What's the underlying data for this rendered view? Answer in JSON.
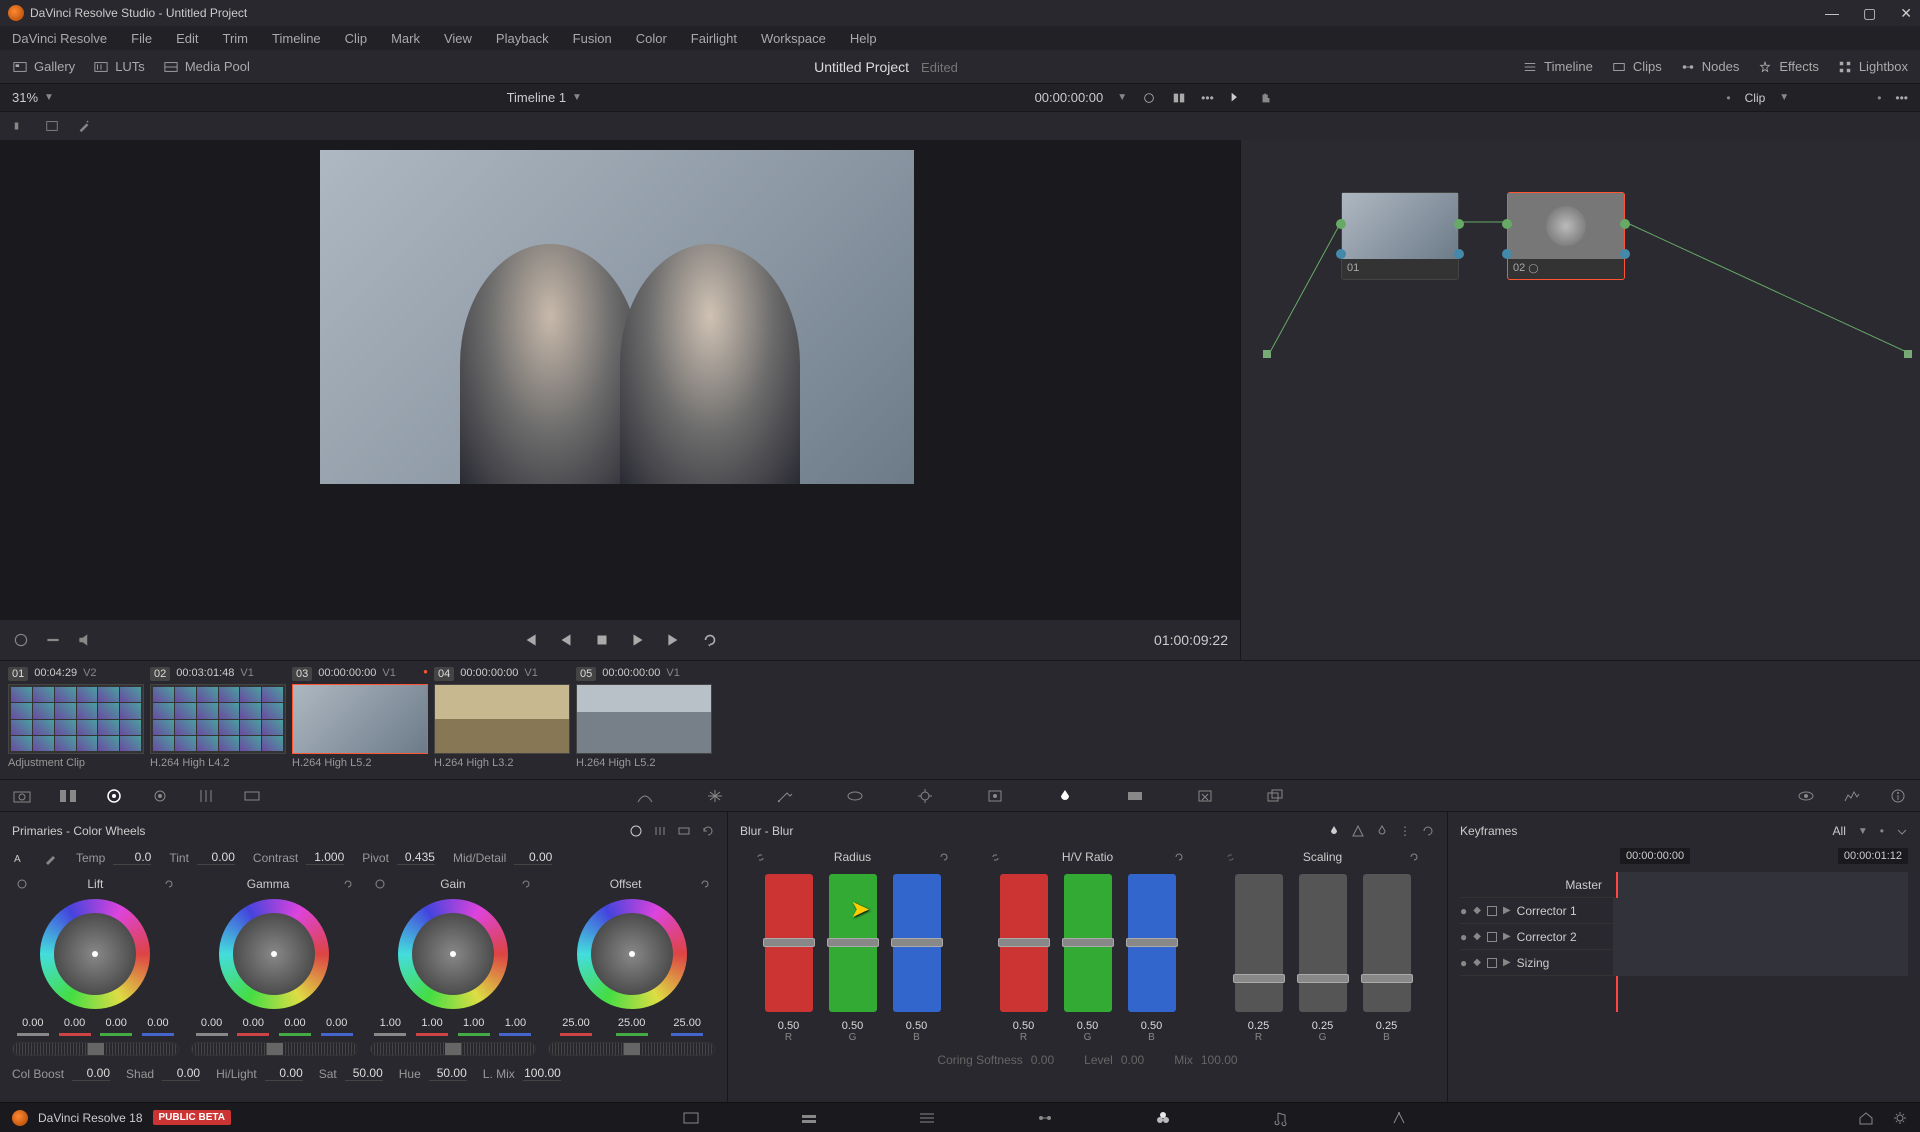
{
  "app": {
    "title": "DaVinci Resolve Studio - Untitled Project",
    "name": "DaVinci Resolve",
    "version": "DaVinci Resolve 18",
    "beta": "PUBLIC BETA"
  },
  "menu": {
    "items": [
      "DaVinci Resolve",
      "File",
      "Edit",
      "Trim",
      "Timeline",
      "Clip",
      "Mark",
      "View",
      "Playback",
      "Fusion",
      "Color",
      "Fairlight",
      "Workspace",
      "Help"
    ]
  },
  "toolbar": {
    "gallery": "Gallery",
    "luts": "LUTs",
    "mediapool": "Media Pool",
    "project": "Untitled Project",
    "edited": "Edited",
    "timeline": "Timeline",
    "clips": "Clips",
    "nodes": "Nodes",
    "effects": "Effects",
    "lightbox": "Lightbox"
  },
  "subbar": {
    "zoom": "31%",
    "timeline": "Timeline 1",
    "timecode": "00:00:00:00",
    "clipmode": "Clip"
  },
  "viewer": {
    "sourceTC": "01:00:09:22"
  },
  "nodes": {
    "n1": "01",
    "n2": "02"
  },
  "clips": [
    {
      "num": "01",
      "tc": "00:04:29",
      "track": "V2",
      "caption": "Adjustment Clip",
      "thumb": "grid",
      "active": false
    },
    {
      "num": "02",
      "tc": "00:03:01:48",
      "track": "V1",
      "caption": "H.264 High L4.2",
      "thumb": "grid",
      "active": false
    },
    {
      "num": "03",
      "tc": "00:00:00:00",
      "track": "V1",
      "caption": "H.264 High L5.2",
      "thumb": "men",
      "active": true
    },
    {
      "num": "04",
      "tc": "00:00:00:00",
      "track": "V1",
      "caption": "H.264 High L3.2",
      "thumb": "road",
      "active": false
    },
    {
      "num": "05",
      "tc": "00:00:00:00",
      "track": "V1",
      "caption": "H.264 High L5.2",
      "thumb": "street",
      "active": false
    }
  ],
  "primaries": {
    "title": "Primaries - Color Wheels",
    "temp_l": "Temp",
    "temp": "0.0",
    "tint_l": "Tint",
    "tint": "0.00",
    "contrast_l": "Contrast",
    "contrast": "1.000",
    "pivot_l": "Pivot",
    "pivot": "0.435",
    "mid_l": "Mid/Detail",
    "mid": "0.00",
    "lift": "Lift",
    "gamma": "Gamma",
    "gain": "Gain",
    "offset": "Offset",
    "lift_v": [
      "0.00",
      "0.00",
      "0.00",
      "0.00"
    ],
    "gamma_v": [
      "0.00",
      "0.00",
      "0.00",
      "0.00"
    ],
    "gain_v": [
      "1.00",
      "1.00",
      "1.00",
      "1.00"
    ],
    "offset_v": [
      "25.00",
      "25.00",
      "25.00"
    ],
    "colboost_l": "Col Boost",
    "colboost": "0.00",
    "shad_l": "Shad",
    "shad": "0.00",
    "hilight_l": "Hi/Light",
    "hilight": "0.00",
    "sat_l": "Sat",
    "sat": "50.00",
    "hue_l": "Hue",
    "hue": "50.00",
    "lmix_l": "L. Mix",
    "lmix": "100.00"
  },
  "blur": {
    "title": "Blur - Blur",
    "radius": "Radius",
    "hvratio": "H/V Ratio",
    "scaling": "Scaling",
    "radius_v": [
      "0.50",
      "0.50",
      "0.50"
    ],
    "radius_c": [
      "R",
      "G",
      "B"
    ],
    "hv_v": [
      "0.50",
      "0.50",
      "0.50"
    ],
    "hv_c": [
      "R",
      "G",
      "B"
    ],
    "scale_v": [
      "0.25",
      "0.25",
      "0.25"
    ],
    "scale_c": [
      "R",
      "G",
      "B"
    ],
    "coring_l": "Coring Softness",
    "coring": "0.00",
    "level_l": "Level",
    "level": "0.00",
    "mix_l": "Mix",
    "mix": "100.00"
  },
  "keyframes": {
    "title": "Keyframes",
    "all": "All",
    "tc1": "00:00:00:00",
    "tc2": "00:00:01:12",
    "rows": [
      "Master",
      "Corrector 1",
      "Corrector 2",
      "Sizing"
    ]
  }
}
